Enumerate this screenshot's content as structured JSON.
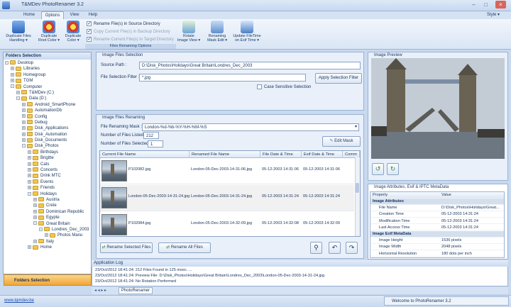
{
  "window": {
    "title": "T&MDev PhotoRenamer 3.2",
    "style_label": "Style ▾"
  },
  "menu": [
    "Home",
    "Options",
    "View",
    "Help"
  ],
  "ribbon": {
    "buttons": [
      {
        "label1": "Duplicate Files",
        "label2": "Handling ▾"
      },
      {
        "label1": "Duplicate",
        "label2": "Root Color ▾"
      },
      {
        "label1": "Duplicate",
        "label2": "Color ▾"
      },
      {
        "label1": "Rotate",
        "label2": "Image View ▾"
      },
      {
        "label1": "Renaming",
        "label2": "Mask Edit ▾"
      },
      {
        "label1": "Update FileTime",
        "label2": "on Exif Time ▾"
      }
    ],
    "options": [
      "Rename File(s) in Source Directory",
      "Copy Current File(s) in Backup Directory",
      "Rename Current File(s) in Target Directory"
    ],
    "group_label": "Files Renaming Options"
  },
  "folders": {
    "title": "Folders Selection",
    "tree": [
      {
        "label": "Desktop",
        "indent": 0,
        "exp": "-"
      },
      {
        "label": "Libraries",
        "indent": 1,
        "exp": "+"
      },
      {
        "label": "Homegroup",
        "indent": 1,
        "exp": "+"
      },
      {
        "label": "TGM",
        "indent": 1,
        "exp": "+"
      },
      {
        "label": "Computer",
        "indent": 1,
        "exp": "-"
      },
      {
        "label": "T&MDev (C:)",
        "indent": 2,
        "exp": "+"
      },
      {
        "label": "Data (D:)",
        "indent": 2,
        "exp": "-"
      },
      {
        "label": "Android_SmartPhone",
        "indent": 3,
        "exp": "+"
      },
      {
        "label": "AutomationDb",
        "indent": 3,
        "exp": "+"
      },
      {
        "label": "Config",
        "indent": 3,
        "exp": "+"
      },
      {
        "label": "Debug",
        "indent": 3,
        "exp": "+"
      },
      {
        "label": "Disk_Applications",
        "indent": 3,
        "exp": "+"
      },
      {
        "label": "Disk_Automation",
        "indent": 3,
        "exp": "+"
      },
      {
        "label": "Disk_Documents",
        "indent": 3,
        "exp": "+"
      },
      {
        "label": "Disk_Photos",
        "indent": 3,
        "exp": "-"
      },
      {
        "label": "Birthdays",
        "indent": 4,
        "exp": "+"
      },
      {
        "label": "Brigitte",
        "indent": 4,
        "exp": "+"
      },
      {
        "label": "Cats",
        "indent": 4,
        "exp": "+"
      },
      {
        "label": "Concerts",
        "indent": 4,
        "exp": "+"
      },
      {
        "label": "Drink MTC",
        "indent": 4,
        "exp": "+"
      },
      {
        "label": "Events",
        "indent": 4,
        "exp": "+"
      },
      {
        "label": "Friends",
        "indent": 4,
        "exp": "+"
      },
      {
        "label": "Holidays",
        "indent": 4,
        "exp": "-"
      },
      {
        "label": "Austria",
        "indent": 5,
        "exp": "+"
      },
      {
        "label": "Crete",
        "indent": 5,
        "exp": "+"
      },
      {
        "label": "Dominican Republic",
        "indent": 5,
        "exp": "+"
      },
      {
        "label": "Egypte",
        "indent": 5,
        "exp": "+"
      },
      {
        "label": "Great Britain",
        "indent": 5,
        "exp": "-"
      },
      {
        "label": "Londres_Dec_2003",
        "indent": 6,
        "exp": "-"
      },
      {
        "label": "Photos Manu",
        "indent": 7,
        "exp": "+"
      },
      {
        "label": "Italy",
        "indent": 5,
        "exp": "+"
      },
      {
        "label": "Home",
        "indent": 4,
        "exp": "+"
      }
    ],
    "bottom_label": "Folders Selection"
  },
  "selection": {
    "title": "Image Files Selection",
    "source_label": "Source Path :",
    "source_value": "D:\\Disk_Photos\\Holidays\\Great Britain\\Londres_Dec_2003",
    "filter_label": "File Selection Filter :",
    "filter_value": "*.jpg",
    "apply_button": "Apply Selection Filter",
    "case_label": "Case Sensitive Selection"
  },
  "renaming": {
    "title": "Image Files Renaming",
    "mask_label": "File Renaming Mask :",
    "mask_value": "London-%d-%b-%Y-%H-%M-%S",
    "listed_label": "Number of Files Listed :",
    "listed_value": "212",
    "selected_label": "Number of Files Selected :",
    "selected_value": "1",
    "edit_mask": "Edit Mask",
    "columns": [
      "Current File Name",
      "Renamed File Name",
      "File Date & Time",
      "Exif Date & Time",
      "Comm"
    ],
    "rows": [
      {
        "current": "P102082.jpg",
        "renamed": "London-05-Dec-2003-14-31-06.jpg",
        "file_dt": "05-12-2003 14:31:06",
        "exif_dt": "05-12-2003 14:31:06"
      },
      {
        "current": "London-05-Dec-2003-14-31-24.jpg",
        "renamed": "London-05-Dec-2003-14-31-24.jpg",
        "file_dt": "05-12-2003 14:31:24",
        "exif_dt": "05-12-2003 14:31:24"
      },
      {
        "current": "P102084.jpg",
        "renamed": "London-05-Dec-2003-14-32-09.jpg",
        "file_dt": "05-12-2003 14:32:08",
        "exif_dt": "05-12-2003 14:32:09"
      }
    ],
    "rename_selected": "Rename Selected Files",
    "rename_all": "Rename All Files"
  },
  "preview": {
    "title": "Image Preview"
  },
  "attributes": {
    "title": "Image Attributes, Exif & IPTC MetaData",
    "col_property": "Property",
    "col_value": "Value",
    "rows": [
      {
        "k": "Image Attributes",
        "v": "",
        "cat": true
      },
      {
        "k": "File Name",
        "v": "D:\\Disk_Photos\\Holidays\\Great..."
      },
      {
        "k": "Creation Time",
        "v": "05-12-2003 14:31:24"
      },
      {
        "k": "Modification Time",
        "v": "05-12-2003 14:31:24"
      },
      {
        "k": "Last Access Time",
        "v": "05-12-2003 14:31:24"
      },
      {
        "k": "Image Exif MetaData",
        "v": "",
        "cat": true
      },
      {
        "k": "Image Height",
        "v": "1536 pixels"
      },
      {
        "k": "Image Width",
        "v": "2048 pixels"
      },
      {
        "k": "Horizontal Resolution",
        "v": "180 dots per inch"
      }
    ]
  },
  "log": {
    "title": "Application Log",
    "lines": [
      "23/Oct/2012 18:41:24: 212 Files Found in 125 msec. ...",
      "23/Oct/2012 18:41:24: Preview File: D:\\Disk_Photos\\Holidays\\Great Britain\\Londres_Dec_2003\\London-05-Dec-2003-14-31-24.jpg",
      "23/Oct/2012 18:41:24: No Rotation Performed"
    ],
    "tab": "PhotoRenamer"
  },
  "status": {
    "link": "www.tgmdev.be",
    "welcome": "Welcome to PhotoRenamer 3.2"
  }
}
